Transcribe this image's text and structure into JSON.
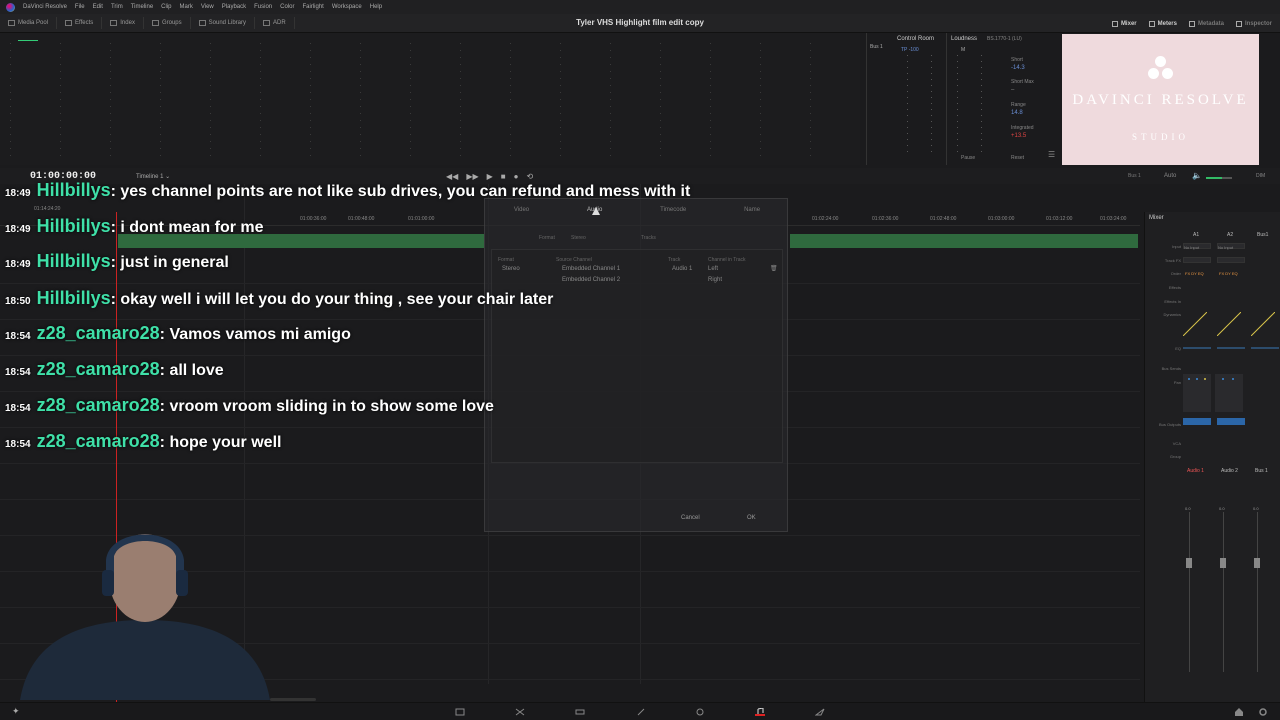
{
  "menu": [
    "DaVinci Resolve",
    "File",
    "Edit",
    "Trim",
    "Timeline",
    "Clip",
    "Mark",
    "View",
    "Playback",
    "Fusion",
    "Color",
    "Fairlight",
    "Workspace",
    "Help"
  ],
  "toolbar": {
    "media_pool": "Media Pool",
    "effects": "Effects",
    "index": "Index",
    "groups": "Groups",
    "sound_library": "Sound Library",
    "adr": "ADR",
    "project_title": "Tyler VHS Highlight film edit copy",
    "mixer": "Mixer",
    "meters": "Meters",
    "metadata": "Metadata",
    "inspector": "Inspector"
  },
  "control_room": {
    "label": "Control Room",
    "bus": "Bus 1",
    "tp": "TP -100",
    "m": "M"
  },
  "loudness": {
    "label": "Loudness",
    "standard": "BS.1770-1 (LU)",
    "short_label": "Short",
    "short_value": "-14.3",
    "short_max_label": "Short Max",
    "short_max_value": "–",
    "range_label": "Range",
    "range_value": "14.8",
    "integrated_label": "Integrated",
    "integrated_value": "+13.5",
    "pause": "Pause",
    "reset": "Reset"
  },
  "viewer": {
    "brand": "DAVINCI RESOLVE",
    "studio": "STUDIO"
  },
  "timeline": {
    "timecode": "01:00:00:00",
    "name": "Timeline 1 ⌄",
    "bus": "Bus 1",
    "auto": "Auto",
    "dim": "DIM",
    "ruler": [
      "01:00:36:00",
      "01:00:48:00",
      "01:01:00:00",
      "01:02:24:00",
      "01:02:36:00",
      "01:02:48:00",
      "01:03:00:00",
      "01:03:12:00",
      "01:03:24:00"
    ],
    "clip_tc": "01:14:24:20"
  },
  "chat": [
    {
      "time": "18:49",
      "user": "Hillbillys",
      "msg": ": yes channel points are not like sub drives, you can refund and mess with it"
    },
    {
      "time": "18:49",
      "user": "Hillbillys",
      "msg": ": i dont mean for me"
    },
    {
      "time": "18:49",
      "user": "Hillbillys",
      "msg": ": just in general"
    },
    {
      "time": "18:50",
      "user": "Hillbillys",
      "msg": ": okay well i will let you do your thing , see your chair later"
    },
    {
      "time": "18:54",
      "user": "z28_camaro28",
      "msg": ": Vamos vamos mi amigo"
    },
    {
      "time": "18:54",
      "user": "z28_camaro28",
      "msg": ": all love"
    },
    {
      "time": "18:54",
      "user": "z28_camaro28",
      "msg": ": vroom vroom sliding in to show some love"
    },
    {
      "time": "18:54",
      "user": "z28_camaro28",
      "msg": ": hope your well"
    }
  ],
  "dialog": {
    "tabs": [
      "Video",
      "Audio",
      "Timecode",
      "Name"
    ],
    "format_top": "Format",
    "stereo_top": "Stereo",
    "tracks_top": "Tracks",
    "format_hdr": "Format",
    "source_channel_hdr": "Source Channel",
    "track_hdr": "Track",
    "channel_in_track_hdr": "Channel in Track",
    "format_value": "Stereo",
    "source_1": "Embedded Channel 1",
    "source_2": "Embedded Channel 2",
    "track_value": "Audio 1",
    "ch_left": "Left",
    "ch_right": "Right",
    "cancel": "Cancel",
    "ok": "OK"
  },
  "mixer": {
    "title": "Mixer",
    "cols": [
      "A1",
      "A2",
      "Bus1"
    ],
    "rows": [
      "Input",
      "Track FX",
      "Order",
      "Effects",
      "Effects In",
      "Dynamics",
      "EQ",
      "Bus Sends",
      "Pan",
      "Bus Outputs",
      "VCA",
      "Group"
    ],
    "input_value": "No Input",
    "order_value": "FX DY EQ",
    "channel_names": [
      "Audio 1",
      "Audio 2",
      "Bus 1"
    ],
    "fader_values": [
      "0.0",
      "0.0",
      "0.0"
    ]
  }
}
